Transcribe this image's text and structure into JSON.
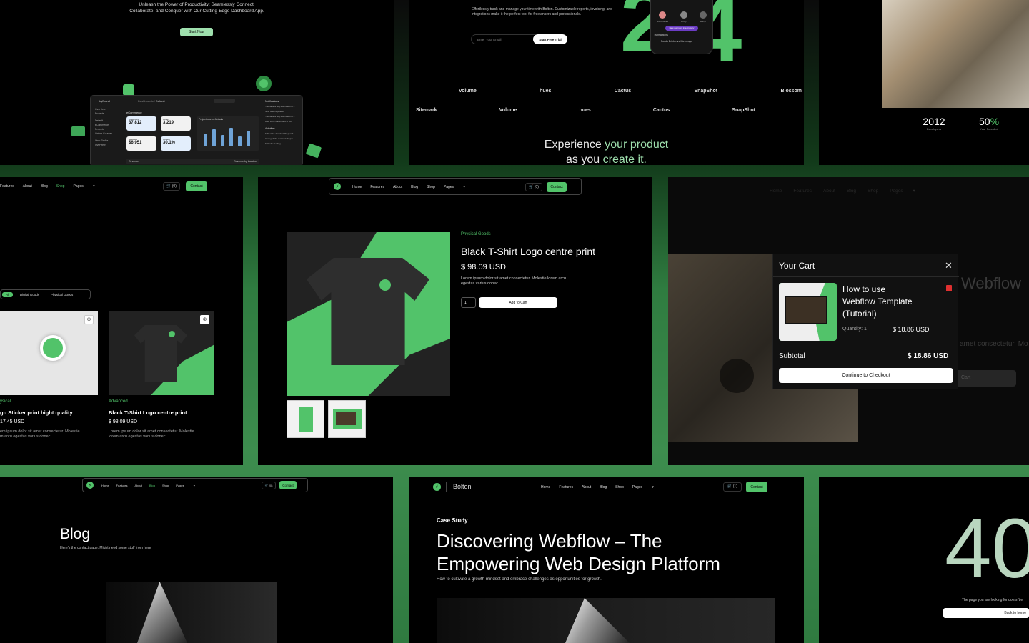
{
  "panel1": {
    "tagline_line1": "Unleash the Power of Productivity: Seamlessly Connect,",
    "tagline_line2": "Collaborate, and Conquer with Our Cutting-Edge Dashboard App.",
    "start_button": "Start Now",
    "dashboard": {
      "app_name": "byBrand",
      "breadcrumb": "Dashboards",
      "breadcrumb_current": "Default",
      "section": "eCommerce",
      "kpis": [
        {
          "label": "Customers",
          "value": "37,812",
          "delta": "+11%"
        },
        {
          "label": "Orders",
          "value": "3,219",
          "delta": "-5%"
        },
        {
          "label": "Revenue",
          "value": "$6,951",
          "delta": "+6%"
        },
        {
          "label": "Growth",
          "value": "30.1%",
          "delta": "+4%"
        }
      ],
      "chart_title": "Projections vs Actuals",
      "notifications_title": "Notifications",
      "notifications": [
        "You have a bug that needs to...",
        "New user registered",
        "You have a bug that needs to...",
        "Andi Lane subscribed to you"
      ],
      "activities_title": "Activities",
      "activities": [
        "Edited the details of Project X",
        "Changed the status of Projec...",
        "Submitted a bug"
      ],
      "sidebar_items": [
        "Overview",
        "Projects",
        "Default",
        "eCommerce",
        "Projects",
        "Online Courses",
        "User Profile",
        "Overview"
      ],
      "revenue_label": "Revenue",
      "revenue_location_label": "Revenue by Location"
    }
  },
  "panel2": {
    "description": "Effortlessly track and manage your time with Bolton. Customizable reports, invoicing, and integrations make it the perfect tool for freelancers and professionals.",
    "email_placeholder": "Enter Your Email",
    "trial_button": "Start Free Trial",
    "big_number_left": "2",
    "big_number_right": "4",
    "phone": {
      "contacts": [
        "Mohammed",
        "Emily",
        "Sheryl"
      ],
      "pill": "New payment in a grocery",
      "list_title": "Transactions",
      "list_item": "Foods Drinks and Beverage"
    },
    "logos_row1": [
      "Volume",
      "hues",
      "Cactus",
      "SnapShot",
      "Blossom"
    ],
    "logos_row2": [
      "Sitemark",
      "Volume",
      "hues",
      "Cactus",
      "SnapShot"
    ],
    "headline_line1_a": "Experience ",
    "headline_line1_b": "your product",
    "headline_line2_a": "as you ",
    "headline_line2_b": "create it."
  },
  "panel3": {
    "stats": [
      {
        "value": "2012",
        "suffix": "",
        "label": "Developers"
      },
      {
        "value": "50",
        "suffix": "%",
        "label": "Year Founded"
      }
    ]
  },
  "panel4": {
    "nav": [
      "Features",
      "About",
      "Blog",
      "Shop",
      "Pages"
    ],
    "cart": "(0)",
    "contact": "Contact",
    "filters": [
      "All",
      "Digital Goods",
      "Physical Goods"
    ],
    "products": [
      {
        "category": "ysical",
        "title": "go Sticker print hight quality",
        "price": "17.45 USD",
        "desc1": "em ipsum dolor sit amet consectetur. Molestie",
        "desc2": "m arcu egestas varius donec."
      },
      {
        "category": "Advanced",
        "title": "Black T-Shirt Logo centre print",
        "price": "$ 98.09 USD",
        "desc1": "Lorem ipsum dolor sit amet consectetur. Molestie",
        "desc2": "lorem arcu egestas varius donec."
      }
    ]
  },
  "panel5": {
    "nav": [
      "Home",
      "Features",
      "About",
      "Blog",
      "Shop",
      "Pages"
    ],
    "cart": "(0)",
    "contact": "Contact",
    "category": "Physical Goods",
    "title": "Black T-Shirt Logo centre print",
    "price": "$ 98.09 USD",
    "desc1": "Lorem ipsum dolor sit amet consectetur. Molestie lorem arcu",
    "desc2": "egestas varius donec.",
    "quantity": "1",
    "add_to_cart": "Add to Cart"
  },
  "panel6": {
    "nav": [
      "Home",
      "Features",
      "About",
      "Blog",
      "Shop",
      "Pages"
    ],
    "bg_heading": "Webflow",
    "bg_text": "amet consectetur. Mo",
    "bg_button": "Cart",
    "cart": {
      "title": "Your Cart",
      "item_title_1": "How to use",
      "item_title_2": "Webflow Template",
      "item_title_3": "(Tutorial)",
      "quantity_label": "Quantity: 1",
      "item_price": "$ 18.86 USD",
      "subtotal_label": "Subtotal",
      "subtotal_value": "$ 18.86 USD",
      "checkout_button": "Continue to Checkout"
    }
  },
  "panel7": {
    "nav": [
      "Home",
      "Features",
      "About",
      "Blog",
      "Shop",
      "Pages"
    ],
    "cart": "(0)",
    "contact": "Contact",
    "title": "Blog",
    "subtitle": "Here's the contact page. Might need some stuff from here"
  },
  "panel8": {
    "brand": "Bolton",
    "nav": [
      "Home",
      "Features",
      "About",
      "Blog",
      "Shop",
      "Pages"
    ],
    "cart": "(1)",
    "contact": "Contact",
    "eyebrow": "Case Study",
    "title_line1": "Discovering Webflow – The",
    "title_line2": "Empowering Web Design Platform",
    "subtitle": "How to cultivate a growth mindset and embrace challenges as opportunities for growth."
  },
  "panel9": {
    "big_text": "40",
    "message": "The page you are looking for doesn't e",
    "button": "Back to home"
  },
  "colors": {
    "accent": "#52c36a",
    "background": "#000000",
    "frame": "#3d8d4e"
  }
}
